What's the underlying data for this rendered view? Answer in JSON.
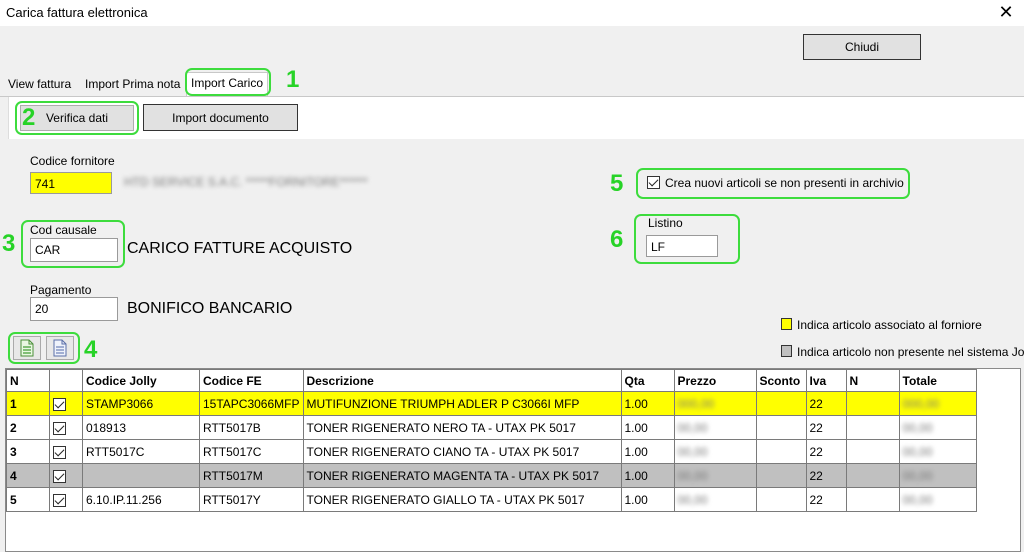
{
  "window": {
    "title": "Carica fattura elettronica",
    "close_glyph": "✕"
  },
  "toolbar": {
    "chiudi_label": "Chiudi"
  },
  "tabs": [
    {
      "label": "View fattura"
    },
    {
      "label": "Import Prima nota"
    },
    {
      "label": "Import Carico"
    }
  ],
  "actions": {
    "verifica_label": "Verifica dati",
    "import_label": "Import documento"
  },
  "markers": [
    "1",
    "2",
    "3",
    "4",
    "5",
    "6"
  ],
  "form": {
    "codice_fornitore_label": "Codice fornitore",
    "codice_fornitore_value": "741",
    "fornitore_name_redacted": "HTD SERVICE S.A.C. *****FORNITORE******",
    "cod_causale_label": "Cod causale",
    "cod_causale_value": "CAR",
    "cod_causale_desc": "CARICO  FATTURE ACQUISTO",
    "pagamento_label": "Pagamento",
    "pagamento_value": "20",
    "pagamento_desc": "BONIFICO BANCARIO",
    "crea_nuovi_label": "Crea nuovi articoli se non presenti in archivio",
    "crea_nuovi_checked": true,
    "listino_label": "Listino",
    "listino_value": "LF"
  },
  "legend": {
    "yellow_label": "Indica articolo associato al forniore",
    "gray_label": "Indica articolo non presente nel sistema Jo",
    "yellow_color": "#ffff00",
    "gray_color": "#c0c0c0"
  },
  "grid": {
    "columns": [
      "N",
      "",
      "Codice Jolly",
      "Codice FE",
      "Descrizione",
      "Qta",
      "Prezzo",
      "Sconto",
      "Iva",
      "N",
      "Totale"
    ],
    "rows": [
      {
        "n": "1",
        "checked": true,
        "jolly": "STAMP3066",
        "fe": "15TAPC3066MFP",
        "desc": "MUTIFUNZIONE TRIUMPH ADLER P C3066I MFP",
        "qta": "1.00",
        "prezzo": "000,00",
        "sconto": "",
        "iva": "22",
        "nn": "",
        "totale": "000,00",
        "style": "yellow"
      },
      {
        "n": "2",
        "checked": true,
        "jolly": "018913",
        "fe": "RTT5017B",
        "desc": "TONER RIGENERATO NERO TA - UTAX PK 5017",
        "qta": "1.00",
        "prezzo": "00,00",
        "sconto": "",
        "iva": "22",
        "nn": "",
        "totale": "00,00",
        "style": "white"
      },
      {
        "n": "3",
        "checked": true,
        "jolly": "RTT5017C",
        "fe": "RTT5017C",
        "desc": "TONER RIGENERATO CIANO TA - UTAX PK 5017",
        "qta": "1.00",
        "prezzo": "00,00",
        "sconto": "",
        "iva": "22",
        "nn": "",
        "totale": "00,00",
        "style": "white"
      },
      {
        "n": "4",
        "checked": true,
        "jolly": "",
        "fe": "RTT5017M",
        "desc": "TONER RIGENERATO MAGENTA TA - UTAX PK 5017",
        "qta": "1.00",
        "prezzo": "00,00",
        "sconto": "",
        "iva": "22",
        "nn": "",
        "totale": "00,00",
        "style": "gray"
      },
      {
        "n": "5",
        "checked": true,
        "jolly": "6.10.IP.11.256",
        "fe": "RTT5017Y",
        "desc": "TONER RIGENERATO GIALLO TA - UTAX PK 5017",
        "qta": "1.00",
        "prezzo": "00,00",
        "sconto": "",
        "iva": "22",
        "nn": "",
        "totale": "00,00",
        "style": "white"
      }
    ]
  }
}
